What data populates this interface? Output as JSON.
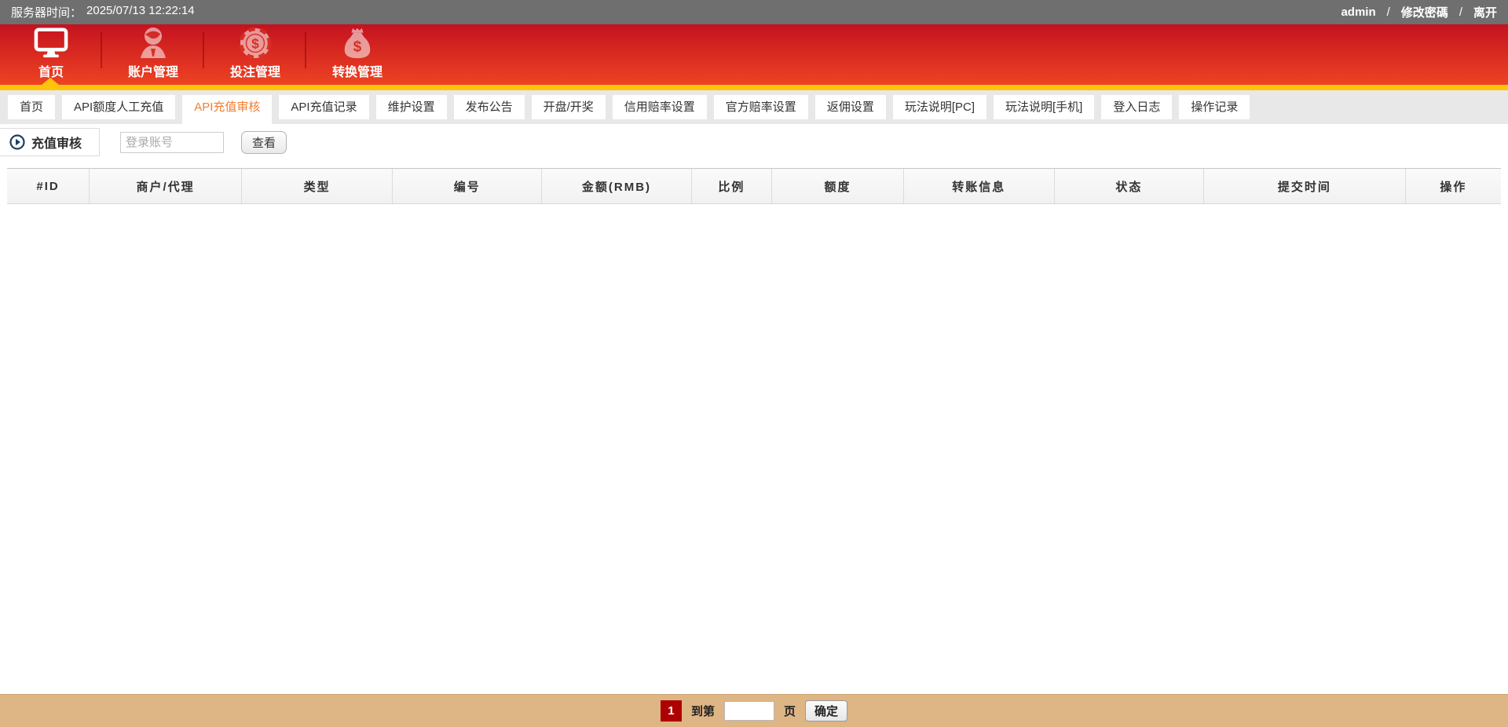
{
  "topbar": {
    "server_time_label": "服务器时间：",
    "server_time": "2025/07/13 12:22:14",
    "username": "admin",
    "sep": "/",
    "change_password": "修改密碼",
    "logout": "离开"
  },
  "nav": {
    "items": [
      {
        "label": "首页",
        "icon": "monitor-icon",
        "active": true
      },
      {
        "label": "账户管理",
        "icon": "user-icon",
        "active": false
      },
      {
        "label": "投注管理",
        "icon": "poker-chip-icon",
        "active": false
      },
      {
        "label": "转换管理",
        "icon": "money-bag-icon",
        "active": false
      }
    ]
  },
  "tabs": [
    {
      "label": "首页"
    },
    {
      "label": "API额度人工充值"
    },
    {
      "label": "API充值审核",
      "active": true
    },
    {
      "label": "API充值记录"
    },
    {
      "label": "维护设置"
    },
    {
      "label": "发布公告"
    },
    {
      "label": "开盘/开奖"
    },
    {
      "label": "信用赔率设置"
    },
    {
      "label": "官方赔率设置"
    },
    {
      "label": "返佣设置"
    },
    {
      "label": "玩法说明[PC]"
    },
    {
      "label": "玩法说明[手机]"
    },
    {
      "label": "登入日志"
    },
    {
      "label": "操作记录"
    }
  ],
  "filter": {
    "section_icon": "play-circle-icon",
    "section_title": "充值审核",
    "account_placeholder": "登录账号",
    "view_button": "查看"
  },
  "table": {
    "columns": [
      "#ID",
      "商户/代理",
      "类型",
      "编号",
      "金额(RMB)",
      "比例",
      "额度",
      "转账信息",
      "状态",
      "提交时间",
      "操作"
    ],
    "rows": []
  },
  "pagination": {
    "current_page": "1",
    "goto_prefix": "到第",
    "goto_suffix": "页",
    "goto_value": "",
    "confirm_button": "确定"
  },
  "colors": {
    "topbar_bg": "#6f6f6f",
    "nav_gradient_top": "#c4121f",
    "nav_gradient_bottom": "#ee4323",
    "yellow_strip": "#ffc30b",
    "tabstrip_bg": "#e8e8e8",
    "active_tab_text": "#f57d2c",
    "pager_bg": "#deb584",
    "current_page_bg": "#ad0000",
    "section_icon_color": "#1c3f63"
  }
}
